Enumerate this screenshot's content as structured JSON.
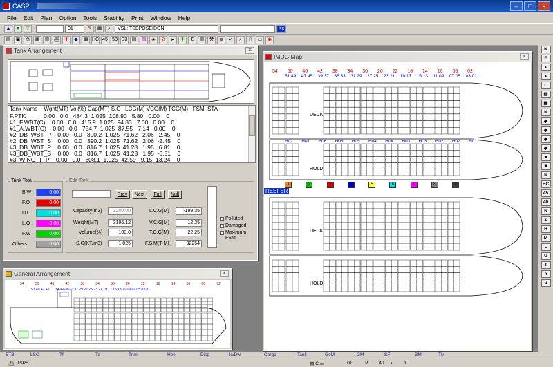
{
  "app": {
    "title": "CASP",
    "window_buttons": [
      "–",
      "□",
      "×"
    ]
  },
  "menu": [
    "File",
    "Edit",
    "Plan",
    "Option",
    "Tools",
    "Stability",
    "Print",
    "Window",
    "Help"
  ],
  "toolbar1": {
    "select_value": "01",
    "vessel": "VSL: TSBPOSEIDON",
    "btn_kc": "Kc"
  },
  "tank_window": {
    "title": "Tank Arrangement",
    "close": "⨯",
    "header": "Tank Name    Wght(MT) Vol(%) Cap(MT) S.G   LCG(M) VCG(M) TCG(M)   FSM  STA",
    "rows": [
      "F.PTK           0.00   0.0   484.3  1.025  108.90   5.80   0.00    0",
      "#1_F.WBT(C)    0.00   0.0   415.9  1.025  94.83   7.00   0.00    0",
      "#1_A.WBT(C)    0.00   0.0   754.7  1.025  87.55   7.14   0.00    0",
      "#2_DB_WBT_P    0.00   0.0   390.2  1.025  71.62   2.06   2.45    0",
      "#2_DB_WBT_S    0.00   0.0   390.2  1.025  71.62   2.06  -2.45    0",
      "#3_DB_WBT_P    0.00   0.0   816.7  1.025  41.28   1.95   6.81    0",
      "#3_DB_WBT_S    0.00   0.0   816.7  1.025  41.28   1.95  -6.81    0",
      "#3_WING_T_P    0.00   0.0   808.1  1.025  42.59   9.15  13.24    0"
    ],
    "tank_total": {
      "label": "Tank Total",
      "items": [
        {
          "name": "B.W",
          "value": "0.00",
          "color": "#2040ff"
        },
        {
          "name": "F.O",
          "value": "0.00",
          "color": "#e00000"
        },
        {
          "name": "D.O",
          "value": "0.00",
          "color": "#00e0e0"
        },
        {
          "name": "L.O",
          "value": "0.00",
          "color": "#ff00ff"
        },
        {
          "name": "F.W",
          "value": "0.00",
          "color": "#00d000"
        },
        {
          "name": "Others",
          "value": "0.00",
          "color": "#a0a0a0"
        }
      ]
    },
    "edit_tank": {
      "label": "Edit Tank",
      "buttons": [
        "Prev",
        "Next",
        "Full",
        "Null"
      ],
      "capacity_label": "Capacity(m3)",
      "capacity": "3200.00",
      "weight_label": "Weight(MT)",
      "weight": "3196.12",
      "volume_label": "Volume(%)",
      "volume": "100.0",
      "sg_label": "S.G(KT/m3)",
      "sg": "1.025",
      "lcg_label": "L.C.G(M)",
      "lcg": "-199.35",
      "vcg_label": "V.C.G(M)",
      "vcg": "12.25",
      "tcg_label": "T.C.G(M)",
      "tcg": "-22.25",
      "fsm_label": "F.S.M(T-M)",
      "fsm": "32254",
      "checks": [
        "Polluted",
        "Damaged",
        "Maximum FSM"
      ]
    }
  },
  "ga_window": {
    "title": "General Arrangement",
    "close": "⨯",
    "bay_top": [
      "54",
      "50",
      "46",
      "42",
      "38",
      "34",
      "30",
      "26",
      "22",
      "18",
      "14",
      "10",
      "06",
      "02"
    ],
    "bay_bottom": "51 49 47 45      39 37 35 33 31 29 27 25 23 21 19 17 15 13 11 09 07 05 03 01"
  },
  "imdg_window": {
    "title": "IMDG Map",
    "close": "⨯",
    "bays_top": [
      "54",
      "50",
      "46",
      "42",
      "38",
      "34",
      "30",
      "26",
      "22",
      "18",
      "14",
      "10",
      "06",
      "02"
    ],
    "bays_sub": [
      "51 49",
      "47 45",
      "39 37",
      "35 33",
      "31 29",
      "27 25",
      "23 21",
      "19 17",
      "15 13",
      "11 09",
      "07 05",
      "03 01"
    ],
    "deck_label": "DECK",
    "hold_label": "HOLD",
    "hatch": [
      "H07",
      "H07",
      "H06",
      "H05",
      "H05",
      "H04",
      "H04",
      "H03",
      "H03",
      "H02",
      "H02",
      "H01"
    ],
    "reefer": "REEFER",
    "classes": [
      {
        "n": "1",
        "color": "#f08020"
      },
      {
        "n": "2",
        "color": "#00c000"
      },
      {
        "n": "3",
        "color": "#e00000"
      },
      {
        "n": "4",
        "color": "#0000d0"
      },
      {
        "n": "5",
        "color": "#ffff40"
      },
      {
        "n": "6",
        "color": "#00e0e0"
      },
      {
        "n": "7",
        "color": "#ff00ff"
      },
      {
        "n": "8",
        "color": "#808080"
      },
      {
        "n": "9",
        "color": "#404040"
      }
    ]
  },
  "right_bar": [
    "N",
    "E",
    "•",
    "▲",
    "□",
    "▤",
    "▦",
    "N",
    "◆",
    "◆",
    "◆",
    "◆",
    "■",
    "■",
    "N",
    "HC",
    "45",
    "40",
    "N",
    "Σ",
    "H",
    "M",
    "L",
    "U",
    "t",
    "h",
    "u"
  ],
  "status_labels": [
    "STB",
    "LSC",
    "Tf",
    "Ta",
    "Trim",
    "Heel",
    "Disp",
    "kvDw",
    "Cargo",
    "Tank",
    "GoM",
    "GM",
    "SF",
    "BM",
    "TM"
  ],
  "status2": [
    "TSPS",
    "01",
    "P",
    "40",
    "1"
  ]
}
